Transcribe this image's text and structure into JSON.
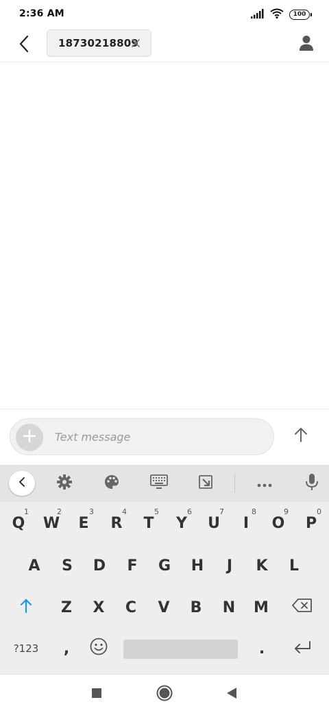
{
  "status_bar": {
    "time": "2:36 AM",
    "battery": "100",
    "icons": [
      "signal-icon",
      "wifi-icon",
      "battery-icon"
    ]
  },
  "header": {
    "back_icon": "back-arrow-icon",
    "recipient": "18730218809",
    "remove_icon": "close-icon",
    "contact_icon": "person-icon"
  },
  "compose": {
    "placeholder": "Text message",
    "attach_icon": "plus-icon",
    "send_icon": "send-arrow-icon"
  },
  "keyboard": {
    "toolbar": [
      "collapse-icon",
      "settings-icon",
      "palette-icon",
      "keyboard-icon",
      "resize-icon",
      "more-icon",
      "mic-icon"
    ],
    "row1": [
      {
        "key": "Q",
        "hint": "1"
      },
      {
        "key": "W",
        "hint": "2"
      },
      {
        "key": "E",
        "hint": "3"
      },
      {
        "key": "R",
        "hint": "4"
      },
      {
        "key": "T",
        "hint": "5"
      },
      {
        "key": "Y",
        "hint": "6"
      },
      {
        "key": "U",
        "hint": "7"
      },
      {
        "key": "I",
        "hint": "8"
      },
      {
        "key": "O",
        "hint": "9"
      },
      {
        "key": "P",
        "hint": "0"
      }
    ],
    "row2": [
      "A",
      "S",
      "D",
      "F",
      "G",
      "H",
      "J",
      "K",
      "L"
    ],
    "row3": [
      "Z",
      "X",
      "C",
      "V",
      "B",
      "N",
      "M"
    ],
    "row4": {
      "symbols": "?123",
      "comma": ",",
      "period": "."
    }
  },
  "nav_bar": [
    "recents-icon",
    "home-icon",
    "back-icon"
  ],
  "colors": {
    "accent_shift": "#2196f3",
    "keyboard_bg": "#eeeeee",
    "toolbar_bg": "#e4e4e4",
    "chip_bg": "#f1f1f1"
  }
}
